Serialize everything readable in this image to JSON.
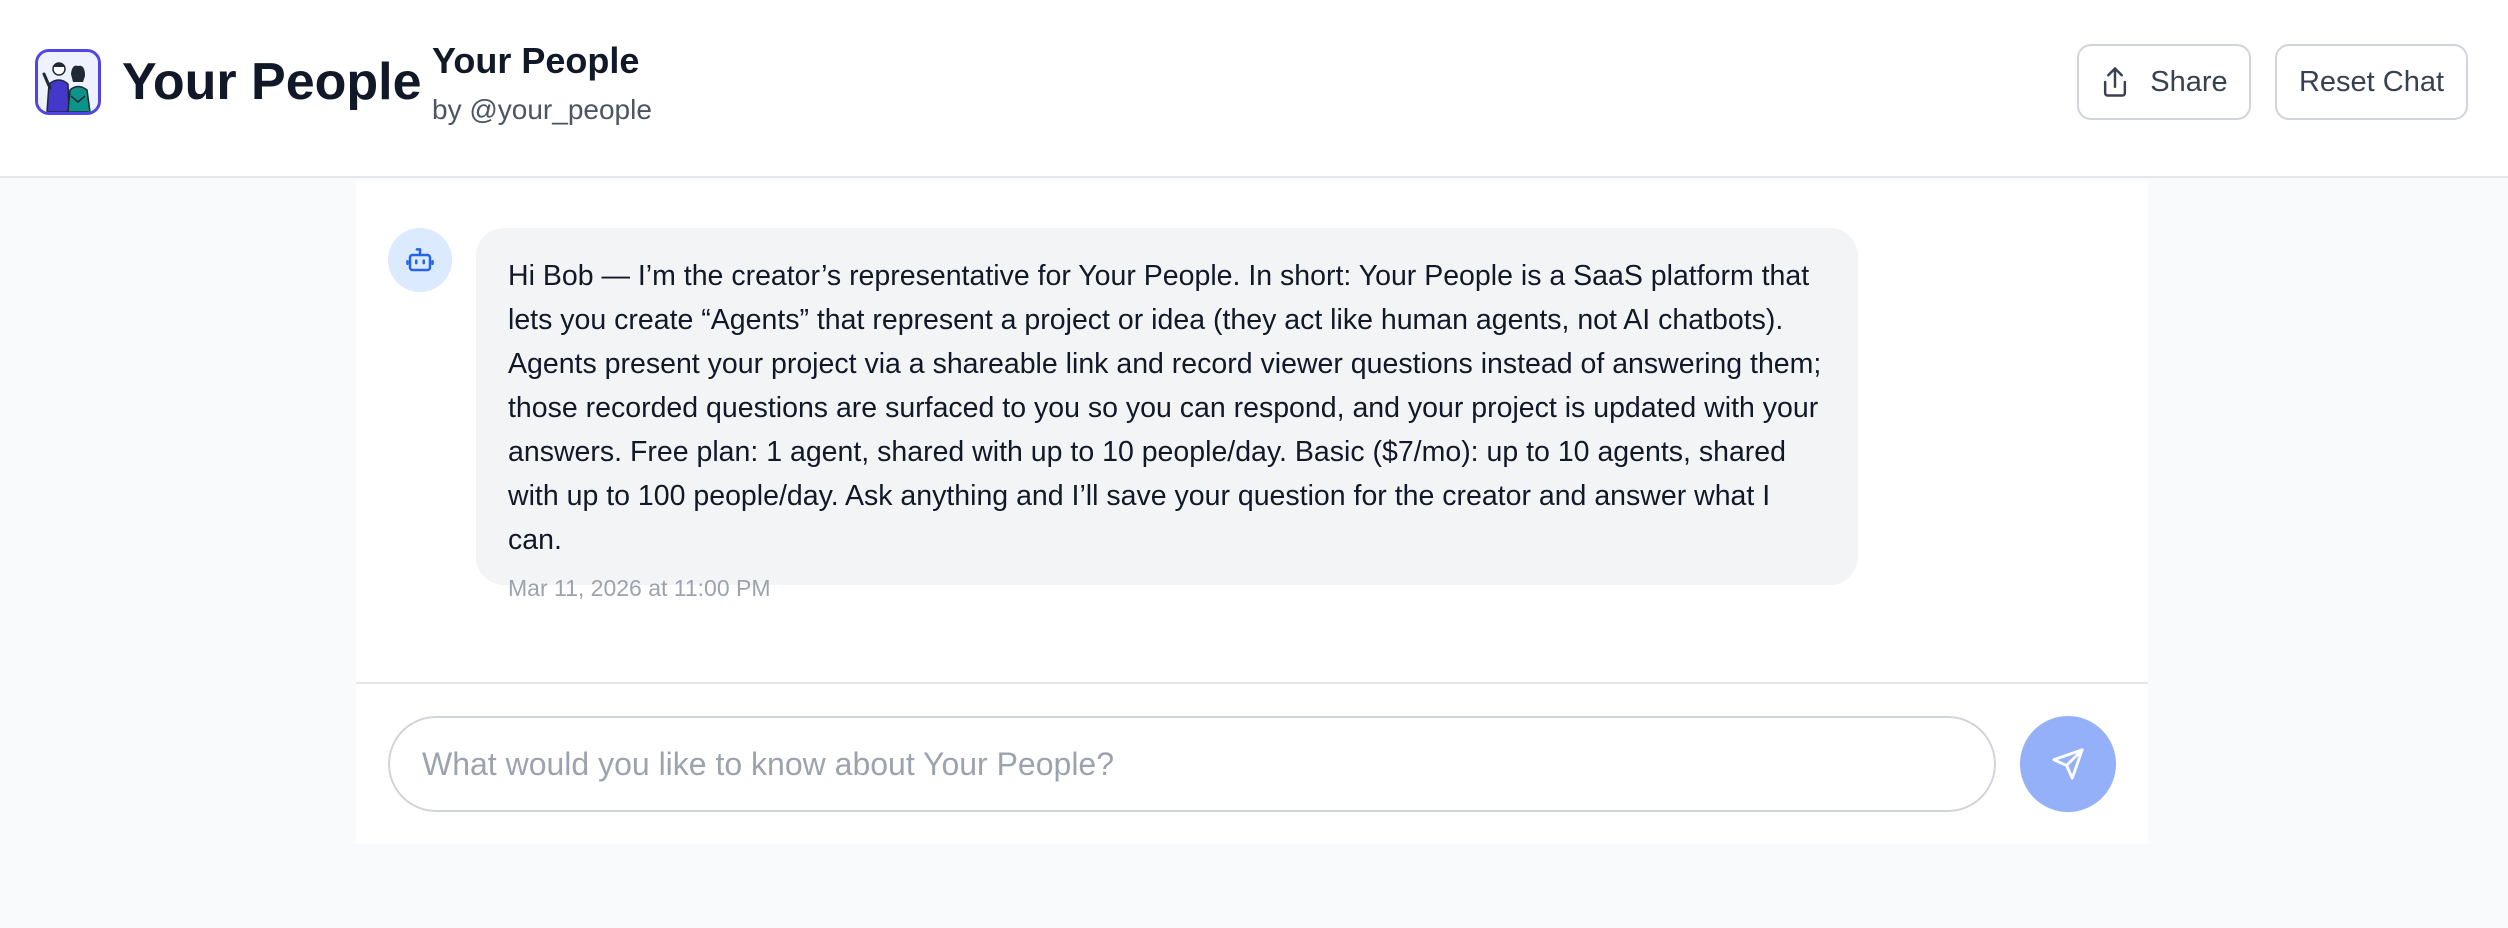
{
  "header": {
    "brand_title": "Your People",
    "agent_name": "Your People",
    "agent_author": "by @your_people",
    "share_label": "Share",
    "reset_label": "Reset Chat"
  },
  "chat": {
    "messages": [
      {
        "sender": "bot",
        "text": "Hi Bob — I’m the creator’s representative for Your People. In short: Your People is a SaaS platform that lets you create “Agents” that represent a project or idea (they act like human agents, not AI chatbots). Agents present your project via a shareable link and record viewer questions instead of answering them; those recorded questions are surfaced to you so you can respond, and your project is updated with your answers. Free plan: 1 agent, shared with up to 10 people/day. Basic ($7/mo): up to 10 agents, shared with up to 100 people/day. Ask anything and I’ll save your question for the creator and answer what I can.",
        "timestamp": "Mar 11, 2026 at 11:00 PM"
      }
    ]
  },
  "input": {
    "placeholder": "What would you like to know about Your People?",
    "value": ""
  },
  "icons": {
    "logo": "people-illustration-icon",
    "share": "share-icon",
    "bot": "robot-icon",
    "send": "send-icon"
  },
  "colors": {
    "accent": "#4f46e5",
    "send_button": "#93b0f8",
    "bot_avatar_bg": "#dbeafe",
    "bot_icon": "#2563eb",
    "bubble_bg": "#f3f4f6",
    "page_bg": "#f9fafb"
  }
}
